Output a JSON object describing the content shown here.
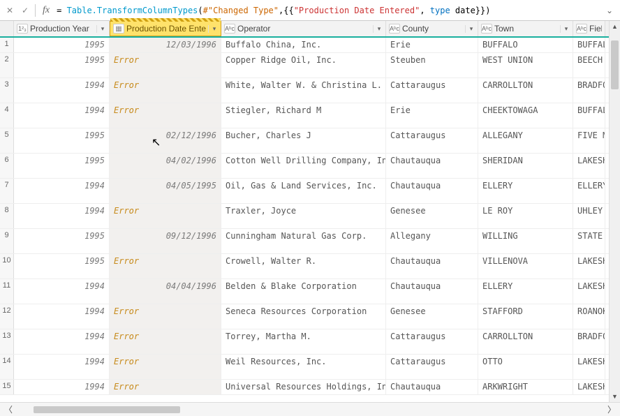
{
  "formula_bar": {
    "text_plain": "= Table.TransformColumnTypes(#\"Changed Type\",{{\"Production Date Entered\", type date}})"
  },
  "columns": [
    {
      "name": "Production Year",
      "type": "number",
      "type_label": "1²₃"
    },
    {
      "name": "Production Date Entered",
      "type": "date",
      "type_label": "▦"
    },
    {
      "name": "Operator",
      "type": "text",
      "type_label": "Aᵇc"
    },
    {
      "name": "County",
      "type": "text",
      "type_label": "Aᵇc"
    },
    {
      "name": "Town",
      "type": "text",
      "type_label": "Aᵇc"
    },
    {
      "name": "Field",
      "type": "text",
      "type_label": "Aᵇc"
    }
  ],
  "rows": [
    {
      "n": 1,
      "year": "1995",
      "date": "12/03/1996",
      "operator": "Buffalo China, Inc.",
      "county": "Erie",
      "town": "BUFFALO",
      "field": "BUFFALO"
    },
    {
      "n": 2,
      "year": "1995",
      "date": "Error",
      "operator": "Copper Ridge Oil, Inc.",
      "county": "Steuben",
      "town": "WEST UNION",
      "field": "BEECH H"
    },
    {
      "n": 3,
      "year": "1994",
      "date": "Error",
      "operator": "White, Walter W. & Christina L.",
      "county": "Cattaraugus",
      "town": "CARROLLTON",
      "field": "BRADFOR"
    },
    {
      "n": 4,
      "year": "1994",
      "date": "Error",
      "operator": "Stiegler, Richard M",
      "county": "Erie",
      "town": "CHEEKTOWAGA",
      "field": "BUFFALO"
    },
    {
      "n": 5,
      "year": "1995",
      "date": "02/12/1996",
      "operator": "Bucher, Charles J",
      "county": "Cattaraugus",
      "town": "ALLEGANY",
      "field": "FIVE MI"
    },
    {
      "n": 6,
      "year": "1995",
      "date": "04/02/1996",
      "operator": "Cotton Well Drilling Company,  Inc.",
      "county": "Chautauqua",
      "town": "SHERIDAN",
      "field": "LAKESHO"
    },
    {
      "n": 7,
      "year": "1994",
      "date": "04/05/1995",
      "operator": "Oil, Gas & Land Services, Inc.",
      "county": "Chautauqua",
      "town": "ELLERY",
      "field": "ELLERY"
    },
    {
      "n": 8,
      "year": "1994",
      "date": "Error",
      "operator": "Traxler, Joyce",
      "county": "Genesee",
      "town": "LE ROY",
      "field": "UHLEY C"
    },
    {
      "n": 9,
      "year": "1995",
      "date": "09/12/1996",
      "operator": "Cunningham Natural Gas Corp.",
      "county": "Allegany",
      "town": "WILLING",
      "field": "STATE L"
    },
    {
      "n": 10,
      "year": "1995",
      "date": "Error",
      "operator": "Crowell, Walter R.",
      "county": "Chautauqua",
      "town": "VILLENOVA",
      "field": "LAKESHO"
    },
    {
      "n": 11,
      "year": "1994",
      "date": "04/04/1996",
      "operator": "Belden & Blake Corporation",
      "county": "Chautauqua",
      "town": "ELLERY",
      "field": "LAKESHO"
    },
    {
      "n": 12,
      "year": "1994",
      "date": "Error",
      "operator": "Seneca Resources Corporation",
      "county": "Genesee",
      "town": "STAFFORD",
      "field": "ROANOKE"
    },
    {
      "n": 13,
      "year": "1994",
      "date": "Error",
      "operator": "Torrey, Martha M.",
      "county": "Cattaraugus",
      "town": "CARROLLTON",
      "field": "BRADFOR"
    },
    {
      "n": 14,
      "year": "1994",
      "date": "Error",
      "operator": "Weil Resources, Inc.",
      "county": "Cattaraugus",
      "town": "OTTO",
      "field": "LAKESHO"
    },
    {
      "n": 15,
      "year": "1994",
      "date": "Error",
      "operator": "Universal Resources Holdings, Incorp",
      "county": "Chautauqua",
      "town": "ARKWRIGHT",
      "field": "LAKESHO"
    }
  ]
}
